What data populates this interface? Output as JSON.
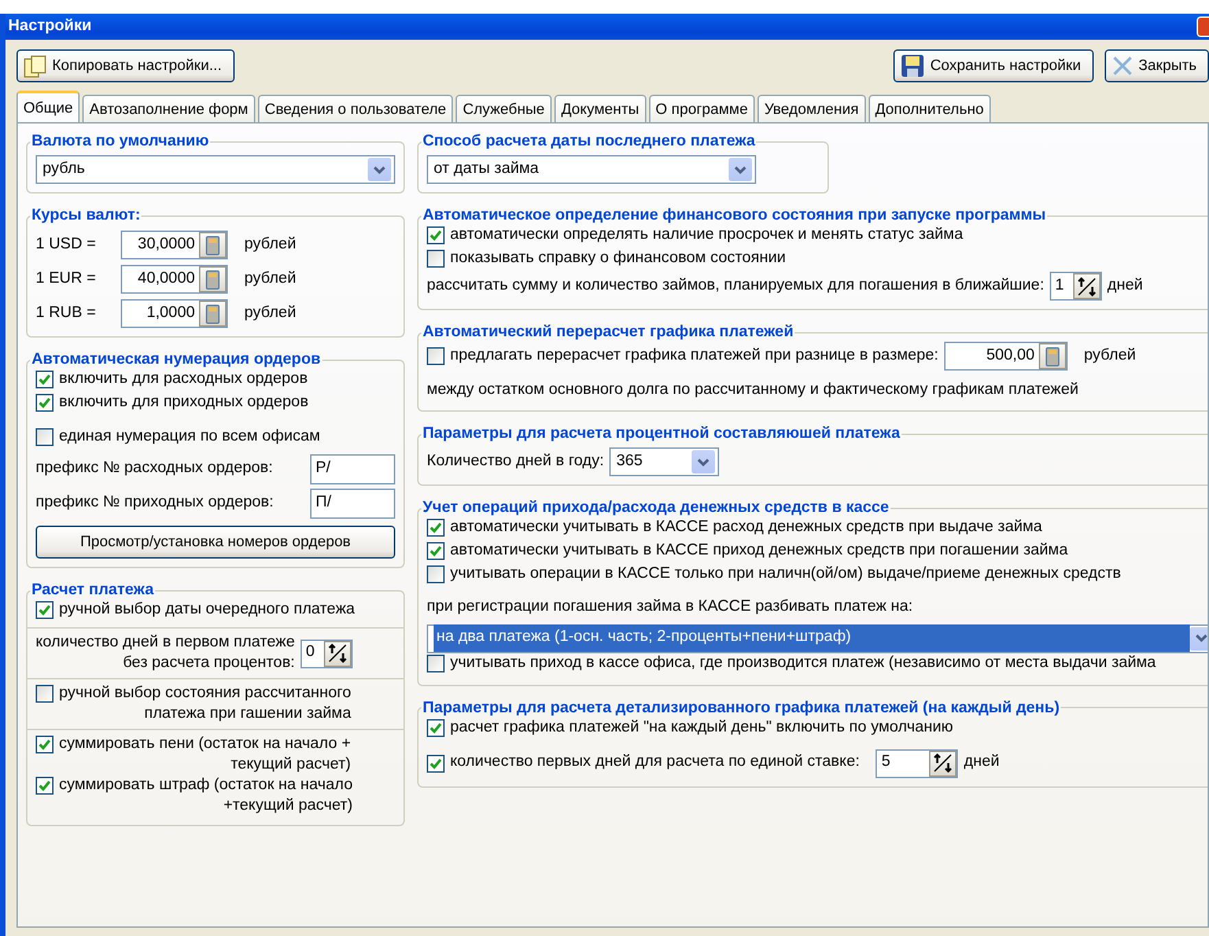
{
  "window": {
    "title": "Настройки"
  },
  "toolbar": {
    "left": [
      {
        "label": "Копировать настройки..."
      }
    ],
    "right": [
      {
        "label": "Сохранить настройки"
      },
      {
        "label": "Закрыть"
      }
    ]
  },
  "tabs": [
    {
      "label": "Общие",
      "selected": true
    },
    {
      "label": "Автозаполнение форм",
      "selected": false
    },
    {
      "label": "Сведения о пользователе",
      "selected": false
    },
    {
      "label": "Служебные",
      "selected": false
    },
    {
      "label": "Документы",
      "selected": false
    },
    {
      "label": "О программе",
      "selected": false
    },
    {
      "label": "Уведомления",
      "selected": false
    },
    {
      "label": "Дополнительно",
      "selected": false
    }
  ],
  "left_column": [
    {
      "title": "Валюта по умолчанию",
      "rows": [
        {
          "kind": "combo",
          "value": "рубль",
          "highlighted": false
        }
      ]
    },
    {
      "title": "Курсы валют:",
      "rows": [
        {
          "kind": "rate",
          "label": "1 USD =",
          "value": "30,0000",
          "unit": "рублей"
        },
        {
          "kind": "rate",
          "label": "1 EUR =",
          "value": "40,0000",
          "unit": "рублей"
        },
        {
          "kind": "rate",
          "label": "1 RUB =",
          "value": "1,0000",
          "unit": "рублей"
        }
      ]
    },
    {
      "title": "Автоматическая нумерация ордеров",
      "rows": [
        {
          "kind": "checkbox",
          "lines": [
            "включить для расходных ордеров"
          ],
          "checked": true
        },
        {
          "kind": "checkbox",
          "lines": [
            "включить для приходных ордеров"
          ],
          "checked": true
        },
        {
          "kind": "gap"
        },
        {
          "kind": "checkbox",
          "lines": [
            "единая нумерация по всем офисам"
          ],
          "checked": false
        },
        {
          "kind": "text_field",
          "label": "префикс № расходных ордеров:",
          "value": "Р/"
        },
        {
          "kind": "text_field",
          "label": "префикс № приходных ордеров:",
          "value": "П/"
        },
        {
          "kind": "button",
          "label": "Просмотр/установка номеров ордеров"
        }
      ]
    },
    {
      "title": "Расчет платежа",
      "rows": [
        {
          "kind": "checkbox",
          "lines": [
            "ручной выбор даты очередного платежа"
          ],
          "checked": true
        },
        {
          "kind": "separator"
        },
        {
          "kind": "spin",
          "lines": [
            "количество дней в первом платеже",
            "без расчета процентов:"
          ],
          "value": "0"
        },
        {
          "kind": "separator"
        },
        {
          "kind": "checkbox",
          "lines": [
            "ручной выбор состояния рассчитанного",
            "платежа при гашении займа"
          ],
          "checked": false
        },
        {
          "kind": "separator"
        },
        {
          "kind": "checkbox",
          "lines": [
            "суммировать пени (остаток на начало +",
            "текущий расчет)"
          ],
          "checked": true
        },
        {
          "kind": "checkbox",
          "lines": [
            "суммировать штраф (остаток на начало",
            "+текущий расчет)"
          ],
          "checked": true
        }
      ]
    }
  ],
  "right_column": [
    {
      "title": "Способ расчета даты последнего платежа",
      "rows": [
        {
          "kind": "combo",
          "value": "от даты займа",
          "highlighted": false
        }
      ]
    },
    {
      "title": "Автоматическое определение финансового состояния при запуске программы",
      "rows": [
        {
          "kind": "checkbox",
          "lines": [
            "автоматически определять наличие просрочек и менять статус займа"
          ],
          "checked": true
        },
        {
          "kind": "checkbox",
          "lines": [
            "показывать справку о финансовом состоянии"
          ],
          "checked": false
        },
        {
          "kind": "spin",
          "lines": [
            "рассчитать сумму и количество займов, планируемых для  погашения в ближайшие:"
          ],
          "value": "1",
          "unit": "дней"
        }
      ]
    },
    {
      "title": "Автоматический перерасчет графика платежей",
      "rows": [
        {
          "kind": "calc_check",
          "label": "предлагать перерасчет графика платежей при разнице в размере:",
          "checked": false,
          "value": "500,00",
          "unit": "рублей"
        },
        {
          "kind": "text",
          "label": "между остатком основного долга по рассчитанному и фактическому графикам платежей"
        }
      ]
    },
    {
      "title": "Параметры для расчета процентной составляюшей платежа",
      "rows": [
        {
          "kind": "combo",
          "label": "Количество дней в году:",
          "value": "365",
          "highlighted": false
        }
      ]
    },
    {
      "title": "Учет операций прихода/расхода денежных средств в кассе",
      "rows": [
        {
          "kind": "checkbox",
          "lines": [
            "автоматически учитывать в КАССЕ расход денежных средств при выдаче займа"
          ],
          "checked": true
        },
        {
          "kind": "checkbox",
          "lines": [
            "автоматически учитывать в КАССЕ приход денежных средств при погашении займа"
          ],
          "checked": true
        },
        {
          "kind": "checkbox",
          "lines": [
            "учитывать операции в КАССЕ только при наличн(ой/ом) выдаче/приеме денежных средств"
          ],
          "checked": false
        },
        {
          "kind": "text",
          "label": "при регистрации погашения займа в КАССЕ разбивать платеж на:"
        },
        {
          "kind": "combo",
          "value": "на два платежа (1-осн. часть; 2-проценты+пени+штраф)",
          "highlighted": true
        },
        {
          "kind": "checkbox",
          "lines": [
            "учитывать приход в кассе офиса, где производится платеж (независимо от места выдачи займа"
          ],
          "checked": false
        }
      ]
    },
    {
      "title": "Параметры для расчета детализированного графика платежей (на каждый день)",
      "rows": [
        {
          "kind": "checkbox",
          "lines": [
            "расчет графика платежей \"на каждый день\" включить по умолчанию"
          ],
          "checked": true
        },
        {
          "kind": "spin_check",
          "label": "количество первых дней для расчета по единой ставке:",
          "checked": true,
          "value": "5",
          "unit": "дней"
        }
      ]
    }
  ]
}
